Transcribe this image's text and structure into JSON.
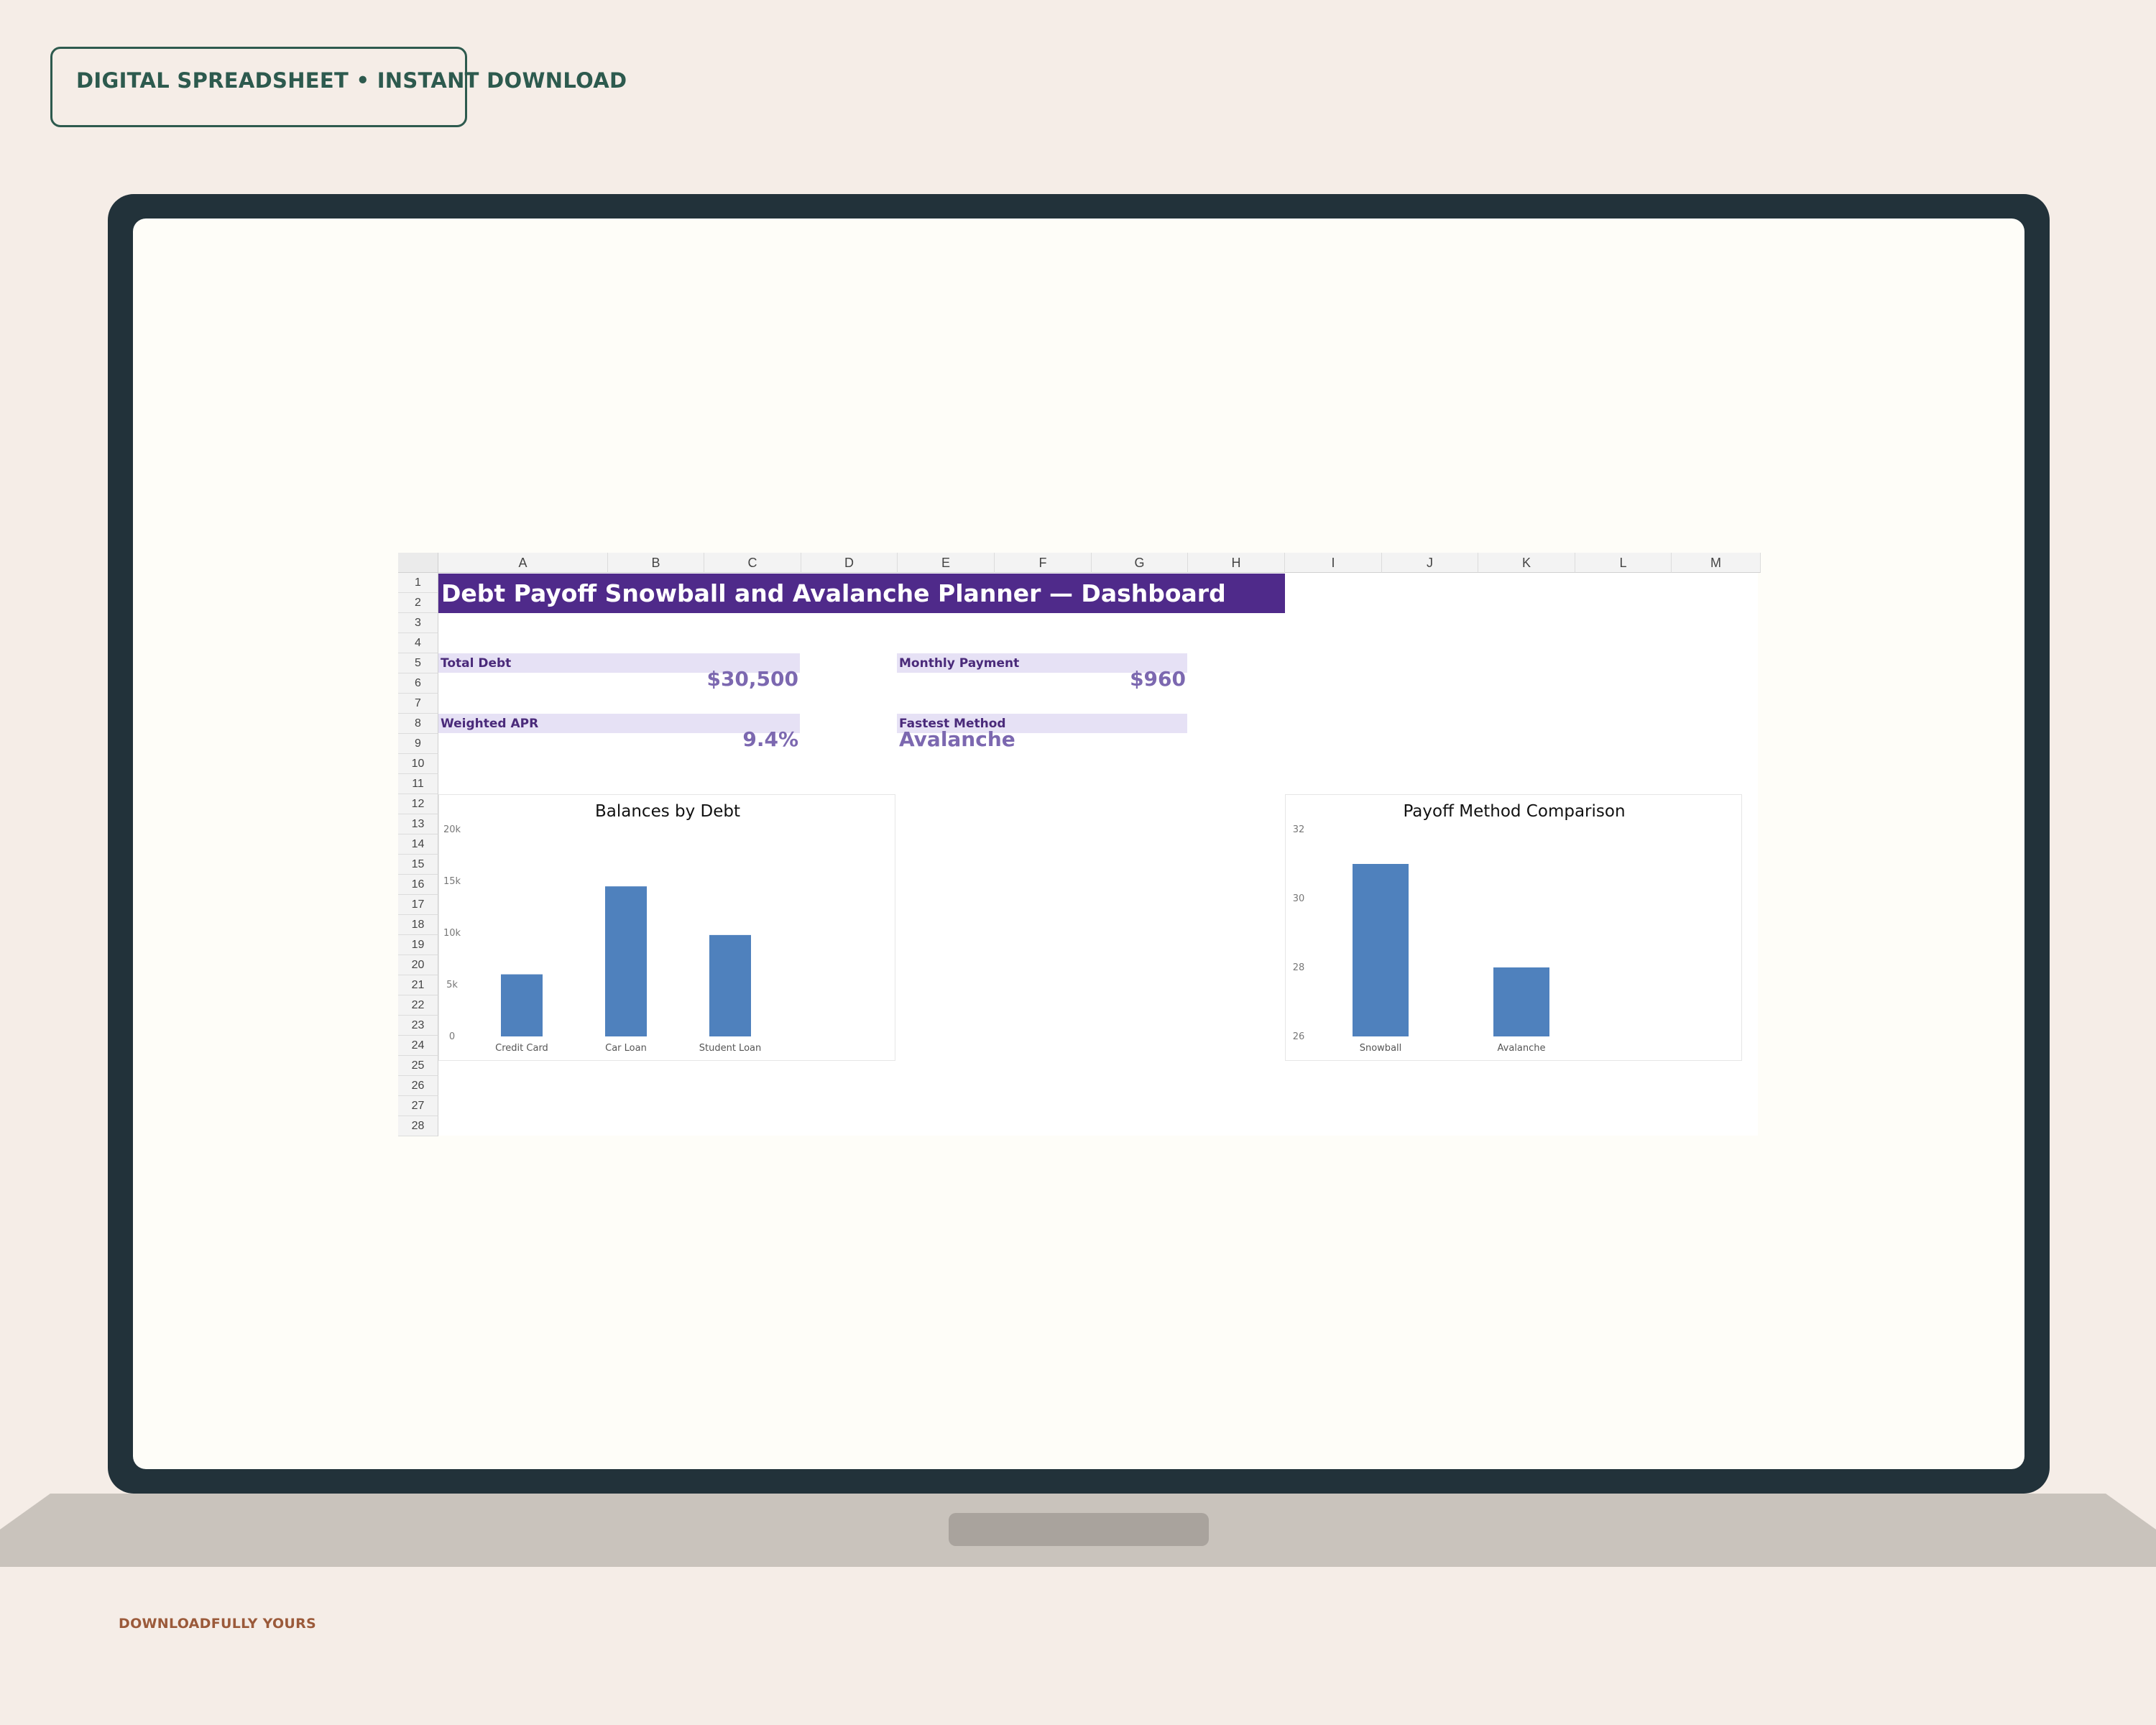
{
  "badge": {
    "text": "DIGITAL SPREADSHEET • INSTANT DOWNLOAD"
  },
  "footer": {
    "text": "DOWNLOADFULLY YOURS"
  },
  "sheet": {
    "columns": [
      "A",
      "B",
      "C",
      "D",
      "E",
      "F",
      "G",
      "H",
      "I",
      "J",
      "K",
      "L",
      "M"
    ],
    "rows": [
      "1",
      "2",
      "3",
      "4",
      "5",
      "6",
      "7",
      "8",
      "9",
      "10",
      "11",
      "12",
      "13",
      "14",
      "15",
      "16",
      "17",
      "18",
      "19",
      "20",
      "21",
      "22",
      "23",
      "24",
      "25",
      "26",
      "27",
      "28"
    ],
    "title": "Debt Payoff Snowball and Avalanche Planner — Dashboard",
    "kpis": {
      "total_debt": {
        "label": "Total Debt",
        "value": "$30,500"
      },
      "monthly_payment": {
        "label": "Monthly Payment",
        "value": "$960"
      },
      "weighted_apr": {
        "label": "Weighted APR",
        "value": "9.4%"
      },
      "fastest_method": {
        "label": "Fastest Method",
        "value": "Avalanche"
      }
    }
  },
  "colors": {
    "title_bg": "#4f2a8a",
    "kpi_label_bg": "#e6e1f5",
    "kpi_value": "#7c68b0",
    "bar": "#4f81bd"
  },
  "chart_data": [
    {
      "type": "bar",
      "title": "Balances by Debt",
      "categories": [
        "Credit Card",
        "Car Loan",
        "Student Loan"
      ],
      "values": [
        6000,
        14500,
        9800
      ],
      "ylim": [
        0,
        20000
      ],
      "yticks": [
        "0",
        "5k",
        "10k",
        "15k",
        "20k"
      ],
      "ytick_values": [
        0,
        5000,
        10000,
        15000,
        20000
      ],
      "xlabel": "",
      "ylabel": "",
      "grid": false,
      "legend": "none"
    },
    {
      "type": "bar",
      "title": "Payoff Method Comparison",
      "categories": [
        "Snowball",
        "Avalanche"
      ],
      "values": [
        31,
        28
      ],
      "ylim": [
        26,
        32
      ],
      "yticks": [
        "26",
        "28",
        "30",
        "32"
      ],
      "ytick_values": [
        26,
        28,
        30,
        32
      ],
      "xlabel": "",
      "ylabel": "",
      "grid": false,
      "legend": "none"
    }
  ]
}
